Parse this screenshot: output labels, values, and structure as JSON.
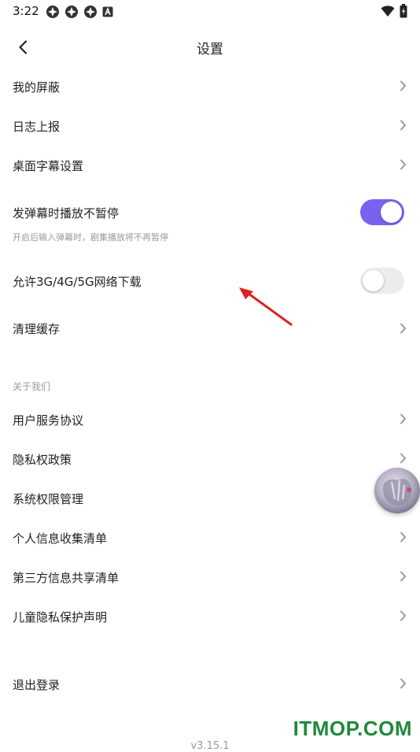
{
  "status_bar": {
    "time": "3:22",
    "left_icons": [
      "app-notification-icon",
      "app-notification-icon",
      "app-notification-icon",
      "a-badge-icon"
    ],
    "right_icons": [
      "wifi-icon",
      "battery-icon"
    ]
  },
  "header": {
    "title": "设置",
    "back_icon": "chevron-left-icon"
  },
  "rows": {
    "shield": "我的屏蔽",
    "log_report": "日志上报",
    "desktop_subtitle": "桌面字幕设置",
    "danmaku_no_pause": "发弹幕时播放不暂停",
    "danmaku_no_pause_desc": "开启后输入弹幕时，剧集播放将不再暂停",
    "allow_mobile_download": "允许3G/4G/5G网络下载",
    "clear_cache": "清理缓存"
  },
  "toggles": {
    "danmaku_no_pause": true,
    "allow_mobile_download": false
  },
  "about": {
    "section_title": "关于我们",
    "user_agreement": "用户服务协议",
    "privacy_policy": "隐私权政策",
    "permissions": "系统权限管理",
    "info_collect": "个人信息收集清单",
    "third_party_share": "第三方信息共享清单",
    "child_privacy": "儿童隐私保护声明"
  },
  "logout": "退出登录",
  "version": "v3.15.1",
  "watermark": "ITMOP.COM",
  "colors": {
    "accent": "#7b61f0",
    "toggle_off": "#ececec",
    "chevron": "#9a9a9a",
    "annotation_arrow": "#e02020",
    "watermark": "#1f8a3a"
  }
}
